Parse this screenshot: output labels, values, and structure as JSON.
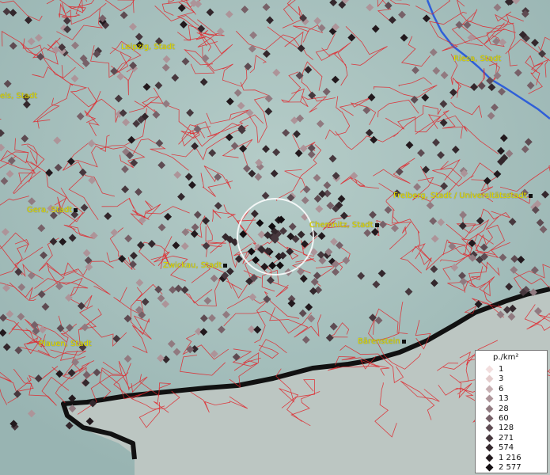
{
  "map": {
    "cities": [
      {
        "name": "Leipzig, Stadt",
        "marker": false
      },
      {
        "name": "Riesa, Stadt",
        "marker": false
      },
      {
        "name": "els, Stadt",
        "marker": false
      },
      {
        "name": "Gera, Stadt",
        "marker": true
      },
      {
        "name": "Freiberg, Stadt / Universitätsstadt",
        "marker": true
      },
      {
        "name": "Chemnitz, Stadt",
        "marker": true
      },
      {
        "name": "Zwickau, Stadt",
        "marker": true
      },
      {
        "name": "Plauen, Stadt",
        "marker": false
      },
      {
        "name": "Bärenstein",
        "marker": true
      }
    ],
    "colors": {
      "background": "#a9c3bf",
      "boundary": "#e0242a",
      "river": "#2f5fd8",
      "label": "#e8e000",
      "selector": "#ffffff"
    },
    "selection_circle": {
      "visible": true
    }
  },
  "legend": {
    "unit": "p./km²",
    "levels": [
      {
        "value": "1",
        "color": "#f2dede"
      },
      {
        "value": "3",
        "color": "#e4cccc"
      },
      {
        "value": "6",
        "color": "#c8b0b3"
      },
      {
        "value": "13",
        "color": "#ad9499"
      },
      {
        "value": "28",
        "color": "#917a80"
      },
      {
        "value": "60",
        "color": "#776168"
      },
      {
        "value": "128",
        "color": "#5e4b52"
      },
      {
        "value": "271",
        "color": "#47383e"
      },
      {
        "value": "574",
        "color": "#33272c"
      },
      {
        "value": "1 216",
        "color": "#22191d"
      },
      {
        "value": "2 577",
        "color": "#120d10"
      }
    ]
  }
}
